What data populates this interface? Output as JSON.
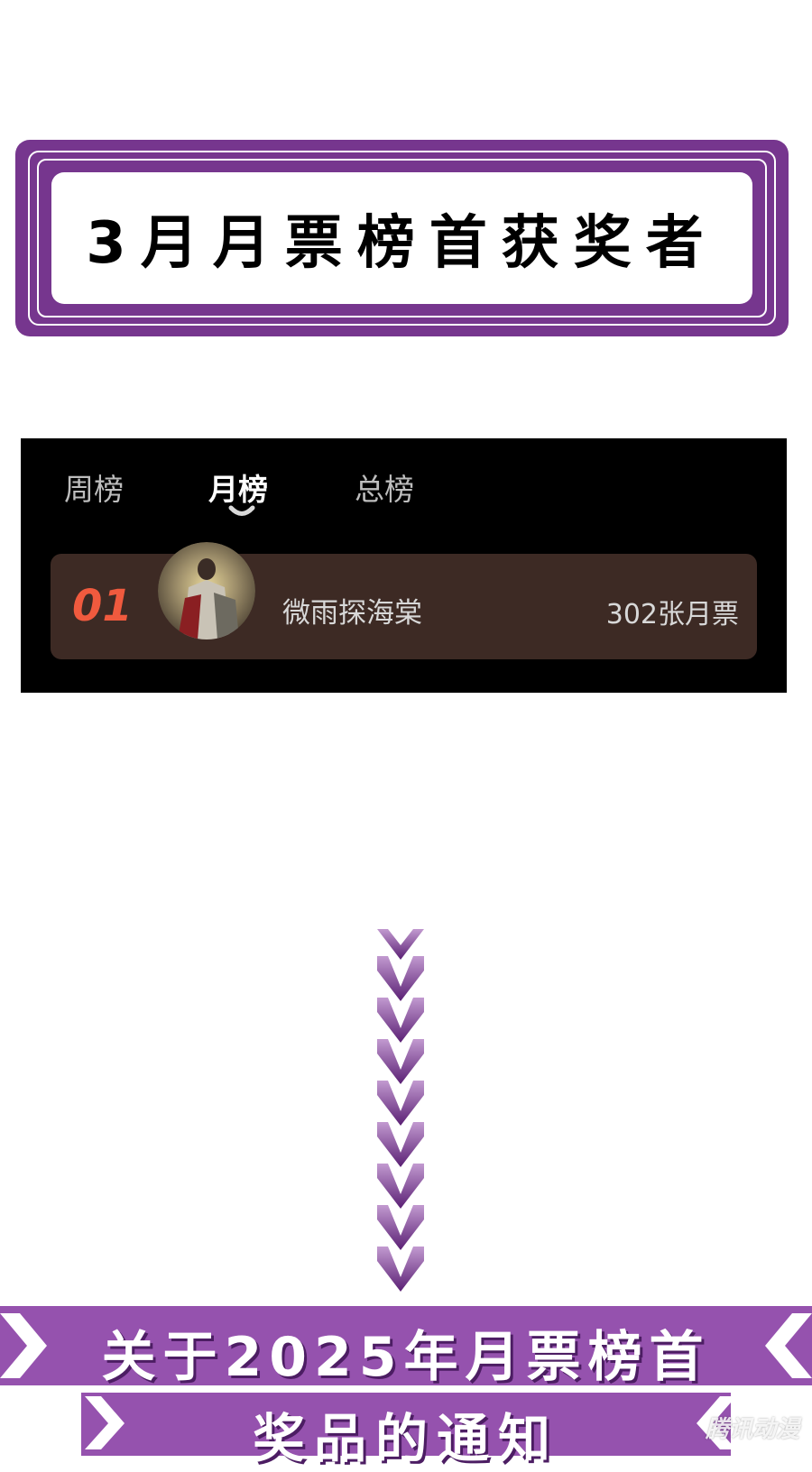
{
  "header": {
    "title": "3月月票榜首获奖者"
  },
  "ranking": {
    "tabs": [
      {
        "label": "周榜",
        "active": false
      },
      {
        "label": "月榜",
        "active": true
      },
      {
        "label": "总榜",
        "active": false
      }
    ],
    "entries": [
      {
        "rank": "01",
        "name": "微雨探海棠",
        "votes": "302张月票"
      }
    ]
  },
  "notice": {
    "line1": "关于2025年月票榜首",
    "line2": "奖品的通知"
  },
  "watermark": "腾讯动漫",
  "colors": {
    "brand_purple": "#76368e",
    "notice_purple": "#9552ae",
    "rank_accent": "#f05a3e",
    "row_bg": "#3d2a24"
  }
}
